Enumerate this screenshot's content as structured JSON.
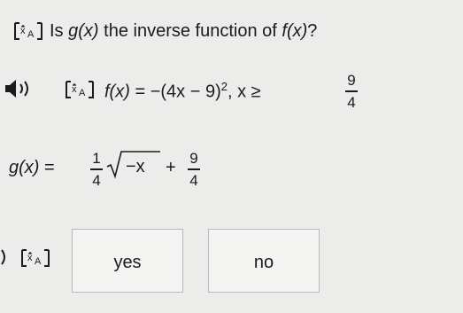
{
  "question": {
    "prefix": "Is",
    "g_of_x": "g(x)",
    "middle": "the inverse function of",
    "f_of_x": "f(x)",
    "suffix": "?"
  },
  "f_expression": {
    "lhs": "f(x)",
    "eq": "=",
    "body": "−(4x − 9)",
    "exponent": "2",
    "domain": ", x ≥",
    "frac_num": "9",
    "frac_den": "4"
  },
  "g_expression": {
    "lhs": "g(x)",
    "eq": "=",
    "coef_num": "1",
    "coef_den": "4",
    "radicand": "−x",
    "plus": "+",
    "frac_num": "9",
    "frac_den": "4"
  },
  "answers": {
    "yes_label": "yes",
    "no_label": "no"
  },
  "icons": {
    "translate": "translate-icon",
    "audio": "speaker-icon"
  },
  "colors": {
    "background": "#ececeb",
    "text": "#1b1b1b",
    "box_border": "#b9b9b9"
  }
}
